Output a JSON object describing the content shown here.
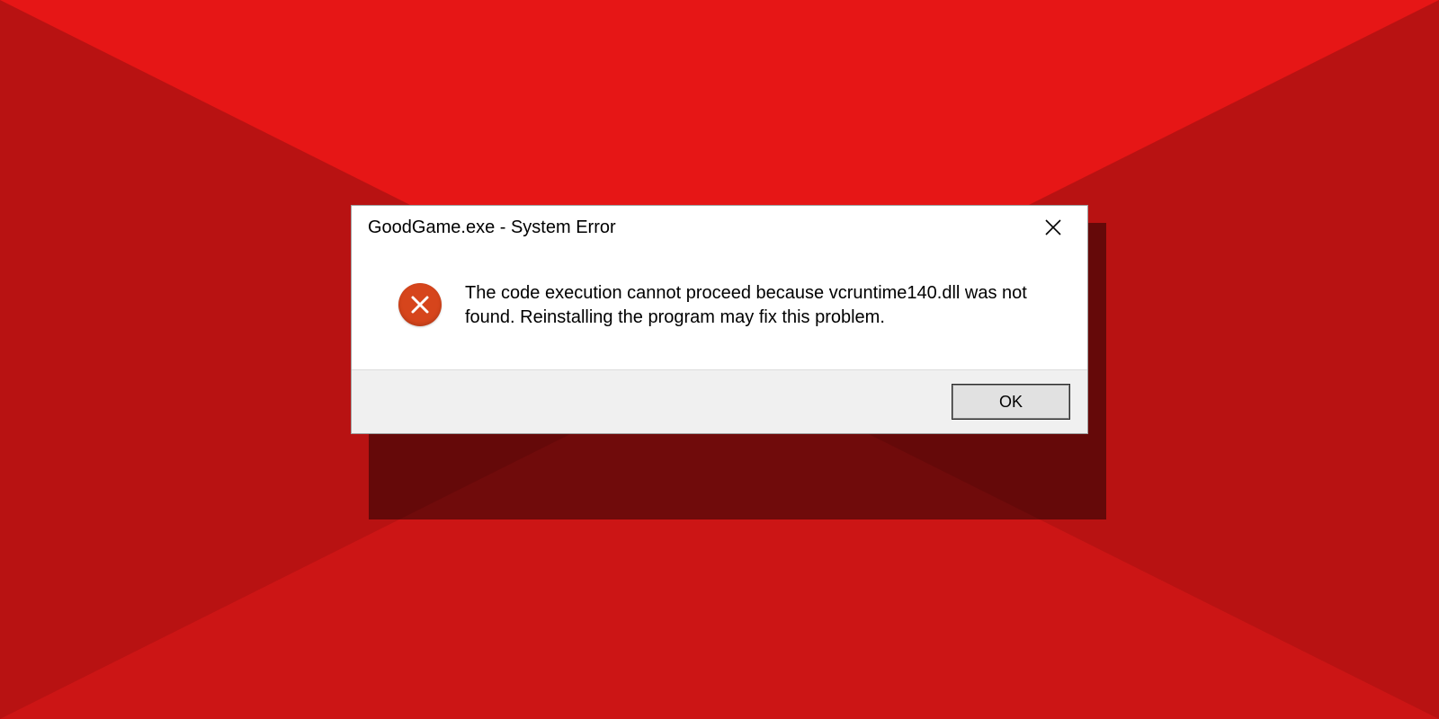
{
  "dialog": {
    "title": "GoodGame.exe - System Error",
    "message": "The code execution cannot proceed because vcruntime140.dll was not found. Reinstalling the program may fix this problem.",
    "ok_label": "OK"
  },
  "icons": {
    "close": "close-icon",
    "error": "error-x-icon"
  },
  "colors": {
    "bg_red_light": "#e61616",
    "bg_red_mid": "#cc1515",
    "bg_red_dark": "#b81212",
    "error_icon": "#d6451c"
  }
}
